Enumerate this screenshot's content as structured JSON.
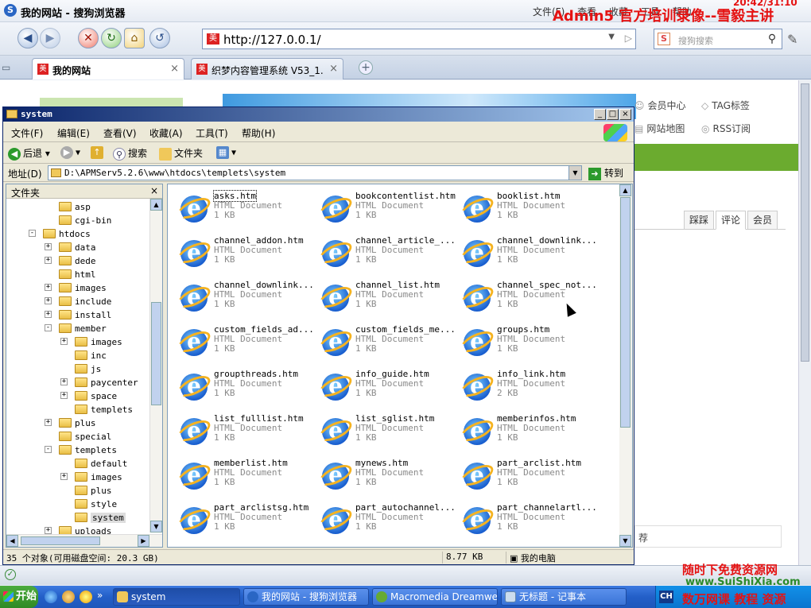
{
  "browser": {
    "title": "我的网站 - 搜狗浏览器",
    "title_menu": [
      "文件(F)",
      "查看",
      "收藏",
      "工具",
      "帮助"
    ],
    "watermark_top": "Admin5 官方培训录像--雪毅主讲",
    "watermark_time": "20:42/31:10",
    "url": "http://127.0.0.1/",
    "url_icon": "美",
    "search_brand": "S",
    "search_placeholder": "搜狗搜索",
    "tabs": [
      {
        "label": "我的网站",
        "icon": "美"
      },
      {
        "label": "织梦内容管理系统 V53_1...",
        "icon": "美"
      }
    ],
    "tab_close": "×",
    "tab_add": "+"
  },
  "website": {
    "links": [
      "会员中心",
      "TAG标签",
      "网站地图",
      "RSS订阅"
    ],
    "side_tabs": [
      "踩踩",
      "评论",
      "会员"
    ],
    "box_text": "荐"
  },
  "explorer": {
    "title": "system",
    "window_buttons": [
      "_",
      "□",
      "×"
    ],
    "menu": [
      "文件(F)",
      "编辑(E)",
      "查看(V)",
      "收藏(A)",
      "工具(T)",
      "帮助(H)"
    ],
    "toolbar": {
      "back": "后退",
      "search": "搜索",
      "folders": "文件夹"
    },
    "address_label": "地址(D)",
    "address": "D:\\APMServ5.2.6\\www\\htdocs\\templets\\system",
    "go_label": "转到",
    "folders_title": "文件夹",
    "folders_close": "×",
    "tree": [
      {
        "label": "asp",
        "level": 3,
        "exp": ""
      },
      {
        "label": "cgi-bin",
        "level": 3,
        "exp": ""
      },
      {
        "label": "htdocs",
        "level": 2,
        "exp": "-"
      },
      {
        "label": "data",
        "level": 3,
        "exp": "+"
      },
      {
        "label": "dede",
        "level": 3,
        "exp": "+"
      },
      {
        "label": "html",
        "level": 3,
        "exp": ""
      },
      {
        "label": "images",
        "level": 3,
        "exp": "+"
      },
      {
        "label": "include",
        "level": 3,
        "exp": "+"
      },
      {
        "label": "install",
        "level": 3,
        "exp": "+"
      },
      {
        "label": "member",
        "level": 3,
        "exp": "-"
      },
      {
        "label": "images",
        "level": 4,
        "exp": "+"
      },
      {
        "label": "inc",
        "level": 4,
        "exp": ""
      },
      {
        "label": "js",
        "level": 4,
        "exp": ""
      },
      {
        "label": "paycenter",
        "level": 4,
        "exp": "+"
      },
      {
        "label": "space",
        "level": 4,
        "exp": "+"
      },
      {
        "label": "templets",
        "level": 4,
        "exp": ""
      },
      {
        "label": "plus",
        "level": 3,
        "exp": "+"
      },
      {
        "label": "special",
        "level": 3,
        "exp": ""
      },
      {
        "label": "templets",
        "level": 3,
        "exp": "-"
      },
      {
        "label": "default",
        "level": 4,
        "exp": ""
      },
      {
        "label": "images",
        "level": 4,
        "exp": "+"
      },
      {
        "label": "plus",
        "level": 4,
        "exp": ""
      },
      {
        "label": "style",
        "level": 4,
        "exp": ""
      },
      {
        "label": "system",
        "level": 4,
        "exp": "",
        "selected": true
      },
      {
        "label": "uploads",
        "level": 3,
        "exp": "+"
      }
    ],
    "files": [
      {
        "name": "asks.htm",
        "type": "HTML Document",
        "size": "1 KB"
      },
      {
        "name": "bookcontentlist.htm",
        "type": "HTML Document",
        "size": "1 KB"
      },
      {
        "name": "booklist.htm",
        "type": "HTML Document",
        "size": "1 KB"
      },
      {
        "name": "channel_addon.htm",
        "type": "HTML Document",
        "size": "1 KB"
      },
      {
        "name": "channel_article_...",
        "type": "HTML Document",
        "size": "1 KB"
      },
      {
        "name": "channel_downlink...",
        "type": "HTML Document",
        "size": "1 KB"
      },
      {
        "name": "channel_downlink...",
        "type": "HTML Document",
        "size": "1 KB"
      },
      {
        "name": "channel_list.htm",
        "type": "HTML Document",
        "size": "1 KB"
      },
      {
        "name": "channel_spec_not...",
        "type": "HTML Document",
        "size": "1 KB"
      },
      {
        "name": "custom_fields_ad...",
        "type": "HTML Document",
        "size": "1 KB"
      },
      {
        "name": "custom_fields_me...",
        "type": "HTML Document",
        "size": "1 KB"
      },
      {
        "name": "groups.htm",
        "type": "HTML Document",
        "size": "1 KB"
      },
      {
        "name": "groupthreads.htm",
        "type": "HTML Document",
        "size": "1 KB"
      },
      {
        "name": "info_guide.htm",
        "type": "HTML Document",
        "size": "1 KB"
      },
      {
        "name": "info_link.htm",
        "type": "HTML Document",
        "size": "2 KB"
      },
      {
        "name": "list_fulllist.htm",
        "type": "HTML Document",
        "size": "1 KB"
      },
      {
        "name": "list_sglist.htm",
        "type": "HTML Document",
        "size": "1 KB"
      },
      {
        "name": "memberinfos.htm",
        "type": "HTML Document",
        "size": "1 KB"
      },
      {
        "name": "memberlist.htm",
        "type": "HTML Document",
        "size": "1 KB"
      },
      {
        "name": "mynews.htm",
        "type": "HTML Document",
        "size": "1 KB"
      },
      {
        "name": "part_arclist.htm",
        "type": "HTML Document",
        "size": "1 KB"
      },
      {
        "name": "part_arclistsg.htm",
        "type": "HTML Document",
        "size": "1 KB"
      },
      {
        "name": "part_autochannel...",
        "type": "HTML Document",
        "size": "1 KB"
      },
      {
        "name": "part_channelartl...",
        "type": "HTML Document",
        "size": "1 KB"
      }
    ],
    "status": {
      "objects": "35 个对象(可用磁盘空间: 20.3 GB)",
      "size": "8.77 KB",
      "location": "我的电脑"
    }
  },
  "watermark_bottom": {
    "line1": "随时下免费资源网",
    "line2": "www.SuiShiXia.com",
    "line3": "数万网课 教程 资源"
  },
  "taskbar": {
    "start": "开始",
    "more": "»",
    "tasks": [
      "system",
      "我的网站 - 搜狗浏览器",
      "Macromedia Dreamwea...",
      "无标题 - 记事本"
    ],
    "tray_lang": "CH"
  }
}
